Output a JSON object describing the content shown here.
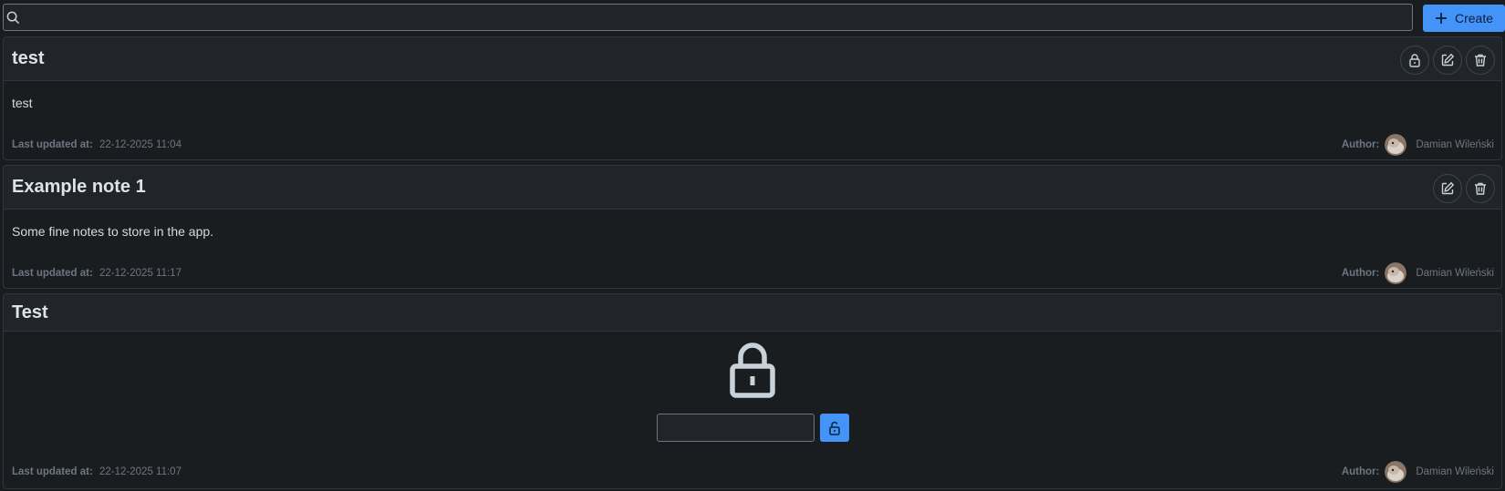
{
  "search": {
    "value": "",
    "placeholder": ""
  },
  "toolbar": {
    "create_label": "Create"
  },
  "labels": {
    "last_updated": "Last updated at:",
    "author": "Author:"
  },
  "notes": [
    {
      "title": "test",
      "content": "test",
      "updated": "22-12-2025 11:04",
      "author": "Damian Wileński",
      "actions": [
        "lock-icon",
        "edit-icon",
        "trash-icon"
      ]
    },
    {
      "title": "Example note 1",
      "content": "Some fine notes to store in the app.",
      "updated": "22-12-2025 11:17",
      "author": "Damian Wileński",
      "actions": [
        "edit-icon",
        "trash-icon"
      ]
    },
    {
      "title": "Test",
      "locked": true,
      "password_value": "",
      "updated": "22-12-2025 11:07",
      "author": "Damian Wileński"
    }
  ],
  "colors": {
    "background": "#1a1d20",
    "card_header": "#212529",
    "accent": "#4493f8",
    "border": "#30363d",
    "muted_text": "#6e7681"
  }
}
